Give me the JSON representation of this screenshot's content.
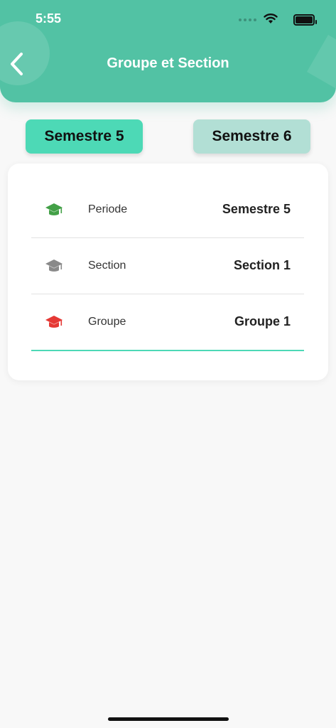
{
  "status_bar": {
    "time": "5:55"
  },
  "header": {
    "title": "Groupe et Section",
    "back_icon": "chevron-left-icon"
  },
  "semester_tabs": [
    {
      "label": "Semestre 5",
      "selected": true,
      "color": "#4dd9b6"
    },
    {
      "label": "Semestre 6",
      "selected": false,
      "color": "#b2dfd5"
    }
  ],
  "info_rows": [
    {
      "icon": "graduation-cap-icon",
      "icon_color": "#43a047",
      "label": "Periode",
      "value": "Semestre 5"
    },
    {
      "icon": "graduation-cap-icon",
      "icon_color": "#8a8a8a",
      "label": "Section",
      "value": "Section 1"
    },
    {
      "icon": "graduation-cap-icon",
      "icon_color": "#e53935",
      "label": "Groupe",
      "value": "Groupe 1"
    }
  ],
  "colors": {
    "accent": "#52c2a4",
    "underline": "#4dd9b6"
  }
}
